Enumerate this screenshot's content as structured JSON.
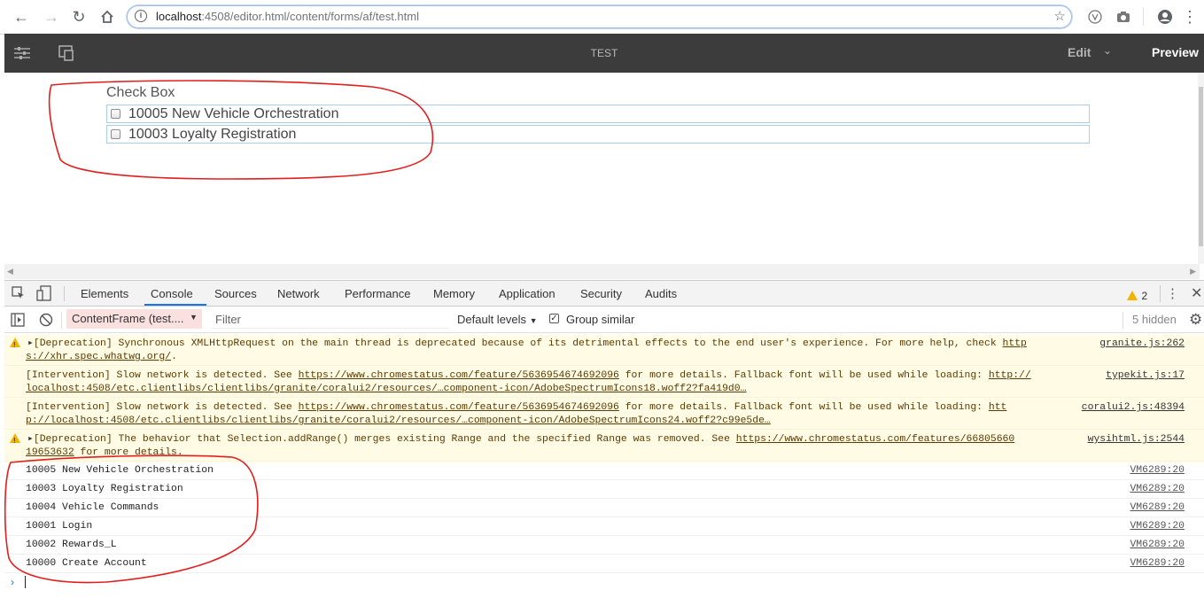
{
  "browser": {
    "url_host": "localhost",
    "url_rest": ":4508/editor.html/content/forms/af/test.html"
  },
  "aem_toolbar": {
    "title": "TEST",
    "edit_label": "Edit",
    "preview_label": "Preview"
  },
  "form": {
    "group_label": "Check Box",
    "options": [
      {
        "label": "10005 New Vehicle Orchestration",
        "checked": false
      },
      {
        "label": "10003 Loyalty Registration",
        "checked": false
      }
    ]
  },
  "devtools": {
    "tabs": [
      "Elements",
      "Console",
      "Sources",
      "Network",
      "Performance",
      "Memory",
      "Application",
      "Security",
      "Audits"
    ],
    "active_tab": "Console",
    "warning_count": "2",
    "context": "ContentFrame (test....",
    "filter_placeholder": "Filter",
    "levels": "Default levels",
    "group_similar": "Group similar",
    "hidden_count": "5 hidden",
    "warnings": [
      {
        "line1_pre": "[Deprecation] Synchronous XMLHttpRequest on the main thread is deprecated because of its detrimental effects to the end user's experience. For more help, check ",
        "line1_link": "http",
        "line2_link": "s://xhr.spec.whatwg.org/",
        "line2_post": ".",
        "source": "granite.js:262"
      },
      {
        "line1_pre": "[Intervention] Slow network is detected. See ",
        "line1_link": "https://www.chromestatus.com/feature/5636954674692096",
        "line1_mid": " for more details. Fallback font will be used while loading: ",
        "line1_link2": "http://",
        "line2_link": "localhost:4508/etc.clientlibs/clientlibs/granite/coralui2/resources/…component-icon/AdobeSpectrumIcons18.woff2?fa419d0…",
        "source": "typekit.js:17"
      },
      {
        "line1_pre": "[Intervention] Slow network is detected. See ",
        "line1_link": "https://www.chromestatus.com/feature/5636954674692096",
        "line1_mid": " for more details. Fallback font will be used while loading: ",
        "line1_link2": "htt",
        "line2_link": "p://localhost:4508/etc.clientlibs/clientlibs/granite/coralui2/resources/…component-icon/AdobeSpectrumIcons24.woff2?c99e5de…",
        "source": "coralui2.js:48394"
      },
      {
        "line1_pre": "[Deprecation] The behavior that Selection.addRange() merges existing Range and the specified Range was removed. See ",
        "line1_link": "https://www.chromestatus.com/features/66805660",
        "line2_link": "19653632",
        "line2_post": " for more details.",
        "source": "wysihtml.js:2544"
      }
    ],
    "logs": [
      {
        "text": "10005 New Vehicle Orchestration",
        "source": "VM6289:20"
      },
      {
        "text": "10003 Loyalty Registration",
        "source": "VM6289:20"
      },
      {
        "text": "10004 Vehicle Commands",
        "source": "VM6289:20"
      },
      {
        "text": "10001 Login",
        "source": "VM6289:20"
      },
      {
        "text": "10002 Rewards_L",
        "source": "VM6289:20"
      },
      {
        "text": "10000 Create Account",
        "source": "VM6289:20"
      }
    ],
    "prompt": "›"
  }
}
